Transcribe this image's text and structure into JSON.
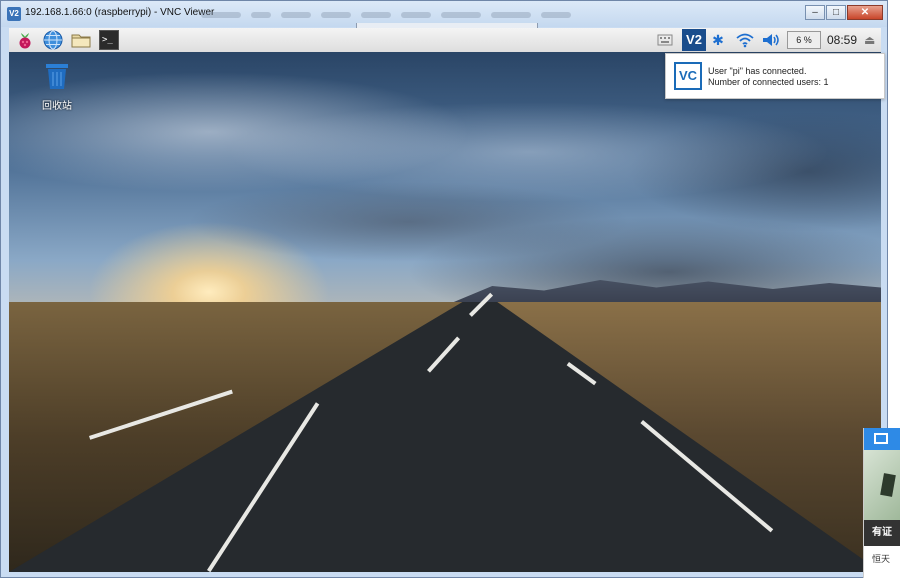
{
  "window": {
    "title": "192.168.1.66:0 (raspberrypi) - VNC Viewer",
    "icon_label": "V2",
    "controls": [
      "minimize",
      "maximize",
      "close"
    ]
  },
  "panel": {
    "launchers": [
      "raspberry-menu-icon",
      "browser-globe-icon",
      "file-manager-folder-icon",
      "terminal-icon"
    ],
    "terminal_glyph": ">_",
    "vnc_tray_label": "V2",
    "cpu_usage": "6 %",
    "clock": "08:59",
    "eject_glyph": "⏏"
  },
  "desktop": {
    "trash_label": "回收站"
  },
  "notification": {
    "logo": "VC",
    "line1": "User \"pi\" has connected.",
    "line2": "Number of connected users: 1"
  },
  "side_widget": {
    "band_text": "有证",
    "bottom_text": "恒天"
  },
  "colors": {
    "accent_vnc": "#1a4d8c",
    "bluetooth": "#1e6fd0",
    "side_header": "#2e8ae6"
  }
}
